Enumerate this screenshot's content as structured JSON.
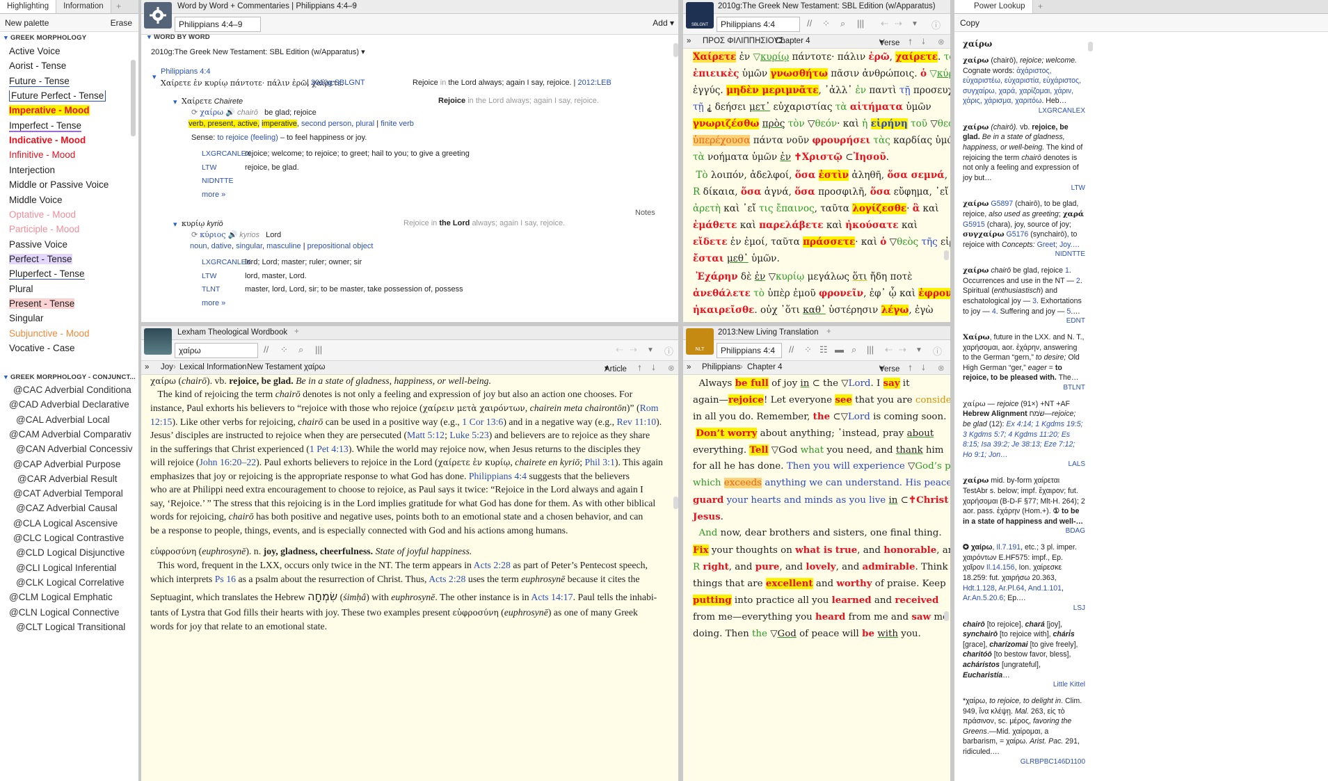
{
  "left": {
    "tabs": [
      "Highlighting",
      "Information"
    ],
    "new_palette": "New palette",
    "erase": "Erase",
    "section1": "GREEK MORPHOLOGY",
    "items": [
      {
        "label": "Active Voice",
        "style": "plain"
      },
      {
        "label": "Aorist - Tense",
        "style": "plain"
      },
      {
        "label": "Future - Tense",
        "style": "blue-under"
      },
      {
        "label": "Future Perfect - Tense",
        "style": "box"
      },
      {
        "label": "Imperative - Mood",
        "style": "red-bold-yellow"
      },
      {
        "label": "Imperfect - Tense",
        "style": "purple-under"
      },
      {
        "label": "Indicative - Mood",
        "style": "red-bold"
      },
      {
        "label": "Infinitive - Mood",
        "style": "red"
      },
      {
        "label": "Interjection",
        "style": "plain"
      },
      {
        "label": "Middle or Passive Voice",
        "style": "plain"
      },
      {
        "label": "Middle Voice",
        "style": "plain"
      },
      {
        "label": "Optative - Mood",
        "style": "pink"
      },
      {
        "label": "Participle - Mood",
        "style": "pink"
      },
      {
        "label": "Passive Voice",
        "style": "plain"
      },
      {
        "label": "Perfect - Tense",
        "style": "lav"
      },
      {
        "label": "Pluperfect - Tense",
        "style": "blue-under"
      },
      {
        "label": "Plural",
        "style": "plain"
      },
      {
        "label": "Present - Tense",
        "style": "pinkbg"
      },
      {
        "label": "Singular",
        "style": "plain"
      },
      {
        "label": "Subjunctive - Mood",
        "style": "orange"
      },
      {
        "label": "Vocative - Case",
        "style": "plain"
      }
    ],
    "section2": "GREEK MORPHOLOGY - CONJUNCT...",
    "items2": [
      "@CAC Adverbial Conditiona",
      "@CAD Adverbial Declarative",
      "@CAL Adverbial Local",
      "@CAM Adverbial Comparativ",
      "@CAN Adverbial Concessiv",
      "@CAP Adverbial Purpose",
      "@CAR Adverbial Result",
      "@CAT Adverbial Temporal",
      "@CAZ Adverbial Causal",
      "@CLA Logical Ascensive",
      "@CLC Logical Contrastive",
      "@CLD Logical Disjunctive",
      "@CLI Logical Inferential",
      "@CLK Logical Correlative",
      "@CLM Logical Emphatic",
      "@CLN Logical Connective",
      "@CLT Logical Transitional"
    ]
  },
  "ww": {
    "tab_title": "Word by Word + Commentaries | Philippians 4:4–9",
    "ref": "Philippians 4:4–9",
    "add": "Add",
    "section": "WORD BY WORD",
    "source": "2010g:The Greek New Testament: SBL Edition (w/Apparatus)",
    "verse_ref": "Philippians 4:4",
    "verse_greek": "Χαίρετε ἐν κυρίῳ πάντοτε· πάλιν ἐρῶ, χαίρετε.",
    "verse_src": "2010g:SBLGNT",
    "verse_eng_a": "Rejoice",
    "verse_eng_b": "in",
    "verse_eng_c": "the Lord always; again I say, rejoice.",
    "verse_eng_src": "2012:LEB",
    "w1_head": "Χαίρετε",
    "w1_translit": "Chairete",
    "w1_eng_bold": "Rejoice",
    "w1_eng_rest": "in the Lord always; again I say, rejoice.",
    "w1_lemma": "χαίρω",
    "w1_lemma_tr": "chairō",
    "w1_gloss": "be glad; rejoice",
    "w1_parse": [
      "verb, present, active,",
      "imperative",
      "second person",
      "plural",
      "finite verb"
    ],
    "w1_sense_label": "Sense:",
    "w1_sense_link": "to rejoice (feeling)",
    "w1_sense_rest": "– to feel happiness or joy.",
    "w1_lex": [
      {
        "src": "LXGRCANLEX",
        "def": "rejoice; welcome; to rejoice; to greet; hail to you; to give a greeting"
      },
      {
        "src": "LTW",
        "def": "rejoice, be glad."
      },
      {
        "src": "NIDNTTE",
        "def": ""
      }
    ],
    "more": "more »",
    "notes": "Notes",
    "w2_head": "κυρίῳ",
    "w2_translit": "kyriō",
    "w2_eng_a": "Rejoice in",
    "w2_eng_bold": "the Lord",
    "w2_eng_rest": "always; again I say, rejoice.",
    "w2_lemma": "κύριος",
    "w2_lemma_tr": "kyrios",
    "w2_gloss": "Lord",
    "w2_parse": [
      "noun",
      "dative",
      "singular",
      "masculine",
      "prepositional object"
    ],
    "w2_lex": [
      {
        "src": "LXGRCANLEX",
        "def": "lord; Lord; master; ruler; owner; sir"
      },
      {
        "src": "LTW",
        "def": "lord, master, Lord."
      },
      {
        "src": "TLNT",
        "def": "master, lord, Lord, sir; to be master, take possession of, possess"
      }
    ]
  },
  "sbl": {
    "tab_title": "2010g:The Greek New Testament: SBL Edition (w/Apparatus)",
    "ref": "Philippians 4:4",
    "crumb_book": "ΠΡΟΣ ΦΙΛΙΠΠΗΣΙΟΥΣ",
    "crumb_chapter": "Chapter 4",
    "verse_btn": "Verse",
    "icon_text": "SBLGNT"
  },
  "ltw": {
    "tab_title": "Lexham Theological Wordbook",
    "search": "χαίρω",
    "crumb": [
      "Joy",
      "Lexical Information",
      "New Testament",
      "χαίρω"
    ],
    "article": "Article"
  },
  "nlt": {
    "tab_title": "2013:New Living Translation",
    "ref": "Philippians 4:4",
    "crumb_book": "Philippians",
    "crumb_chapter": "Chapter 4",
    "verse_btn": "Verse",
    "icon_text": "NLT"
  },
  "power": {
    "tab_title": "Power Lookup",
    "copy": "Copy",
    "lemma": "χαίρω"
  },
  "colors": {
    "accent": "#2a4fb9",
    "highlight_yellow": "#fff200",
    "red_text": "#e8111e",
    "green_text": "#2d9a26",
    "cream_bg": "#fffde8"
  }
}
